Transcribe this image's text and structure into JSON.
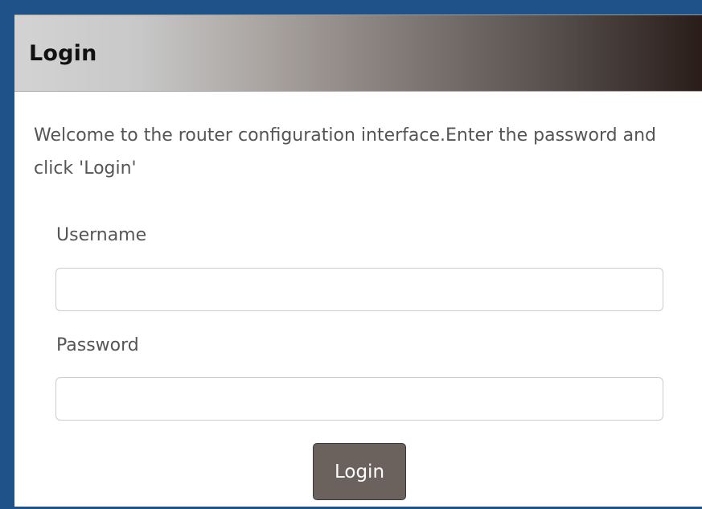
{
  "colors": {
    "window_frame": "#1f5289",
    "panel_background": "#ffffff",
    "header_gradient_start": "#d3d3d3",
    "header_gradient_end": "#2a1d19",
    "text": "#555555",
    "button_background": "#6b625e",
    "button_text": "#ffffff"
  },
  "login_panel": {
    "title": "Login",
    "welcome_message": "Welcome to the router configuration interface.Enter the password and click 'Login'",
    "username": {
      "label": "Username",
      "value": "",
      "placeholder": ""
    },
    "password": {
      "label": "Password",
      "value": "",
      "placeholder": ""
    },
    "submit_label": "Login"
  }
}
